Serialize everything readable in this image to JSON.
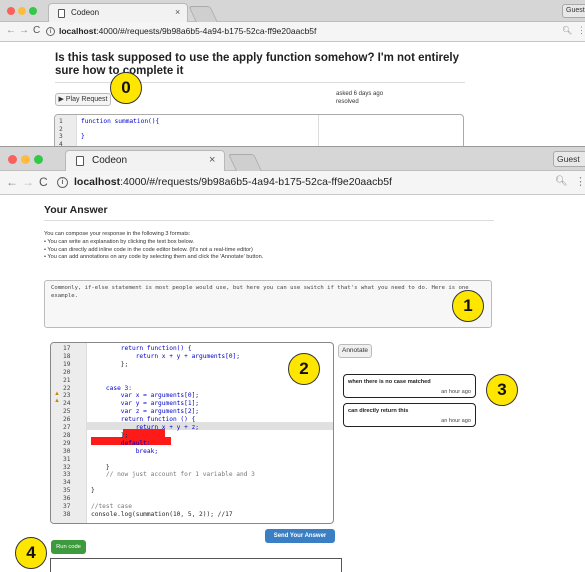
{
  "back_window": {
    "tab_title": "Codeon",
    "guest_label": "Guest",
    "url_host": "localhost",
    "url_rest": ":4000/#/requests/9b98a6b5-4a94-b175-52ca-ff9e20aacb5f",
    "question_title": "Is this task supposed to use the apply function somehow? I'm not entirely sure how to complete it",
    "play_label": "▶ Play Request",
    "asked_text": "asked 6 days ago",
    "status_text": "resolved",
    "code_lines": [
      {
        "n": "1",
        "text": "function summation(){"
      },
      {
        "n": "2",
        "text": ""
      },
      {
        "n": "3",
        "text": "}"
      },
      {
        "n": "4",
        "text": ""
      }
    ]
  },
  "front_window": {
    "tab_title": "Codeon",
    "guest_label": "Guest",
    "url_host": "localhost",
    "url_rest": ":4000/#/requests/9b98a6b5-4a94-b175-52ca-ff9e20aacb5f",
    "heading": "Your Answer",
    "instructions_intro": "You can compose your response in the following 3 formats:",
    "instructions": [
      "• You can write an explanation by clicking the text box below.",
      "• You can directly add inline code in the code editor below. (It's not a real-time editor)",
      "• You can add annotations on any code by selecting them and click the 'Annotate' button."
    ],
    "explanation_text": "Commonly, if-else statement is most people would use, but here you can use switch if that's what you need to do. Here is one example.",
    "annotate_label": "Annotate",
    "send_label": "Send Your Answer",
    "run_label": "Run code",
    "comments": [
      {
        "text": "when there is no case matched",
        "time": "an hour ago"
      },
      {
        "text": "can directly return this",
        "time": "an hour ago"
      }
    ],
    "code_lines": [
      {
        "n": "17",
        "text": "        return function() {"
      },
      {
        "n": "18",
        "text": "            return x + y + arguments[0];"
      },
      {
        "n": "19",
        "text": "        };"
      },
      {
        "n": "20",
        "text": ""
      },
      {
        "n": "21",
        "text": ""
      },
      {
        "n": "22",
        "text": "    case 3:"
      },
      {
        "n": "23",
        "text": "        var x = arguments[0];"
      },
      {
        "n": "24",
        "text": "        var y = arguments[1];"
      },
      {
        "n": "25",
        "text": "        var z = arguments[2];"
      },
      {
        "n": "26",
        "text": "        return function () {"
      },
      {
        "n": "27",
        "text": "            return x + y + z;"
      },
      {
        "n": "28",
        "text": "        };"
      },
      {
        "n": "29",
        "text": "        default:"
      },
      {
        "n": "30",
        "text": "            break;"
      },
      {
        "n": "31",
        "text": ""
      },
      {
        "n": "32",
        "text": "    }"
      },
      {
        "n": "33",
        "text": "    // now just account for 1 variable and 3"
      },
      {
        "n": "34",
        "text": ""
      },
      {
        "n": "35",
        "text": "}"
      },
      {
        "n": "36",
        "text": ""
      },
      {
        "n": "37",
        "text": "//test case"
      },
      {
        "n": "38",
        "text": "console.log(summation(10, 5, 2)); //17"
      }
    ]
  },
  "markers": [
    "0",
    "1",
    "2",
    "3",
    "4"
  ],
  "colors": {
    "accent_blue": "#3a7fc4",
    "run_green": "#3d9b3d",
    "highlight_red": "#ff1a1a",
    "marker_yellow": "#ffe600"
  }
}
